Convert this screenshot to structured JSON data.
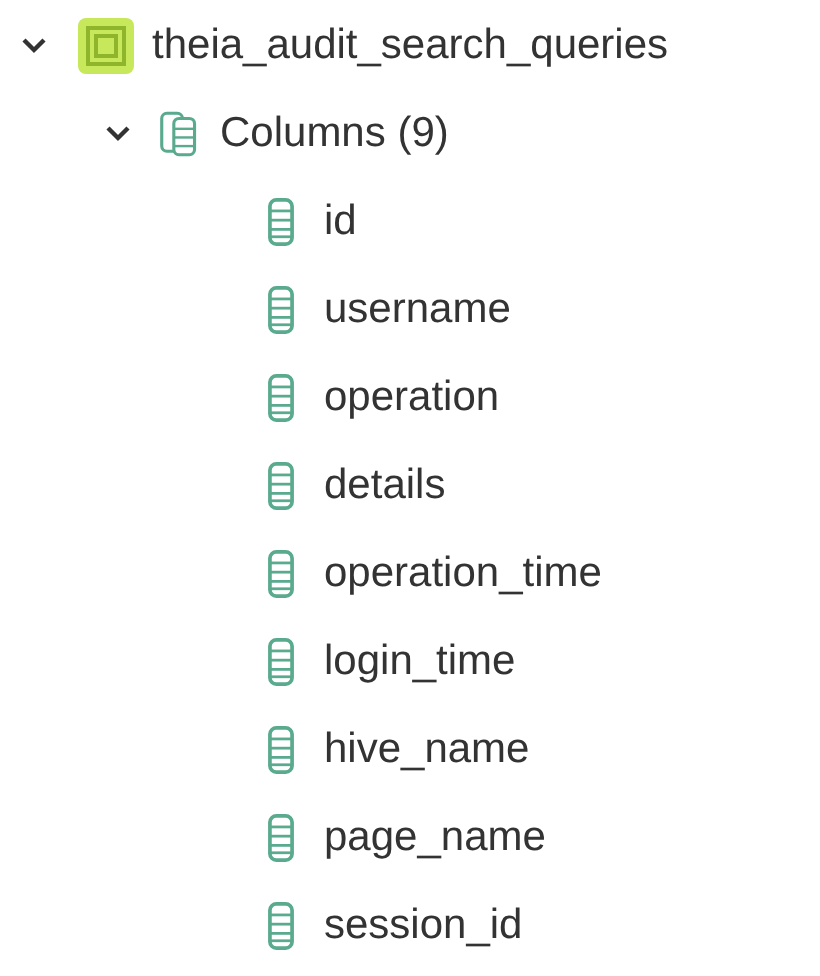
{
  "tree": [
    {
      "kind": "table",
      "label": "theia_audit_search_queries",
      "expanded": true,
      "children": [
        {
          "kind": "folder",
          "label": "Columns (9)",
          "expanded": true,
          "children": [
            {
              "kind": "column",
              "label": "id"
            },
            {
              "kind": "column",
              "label": "username"
            },
            {
              "kind": "column",
              "label": "operation"
            },
            {
              "kind": "column",
              "label": "details"
            },
            {
              "kind": "column",
              "label": "operation_time"
            },
            {
              "kind": "column",
              "label": "login_time"
            },
            {
              "kind": "column",
              "label": "hive_name"
            },
            {
              "kind": "column",
              "label": "page_name"
            },
            {
              "kind": "column",
              "label": "session_id"
            }
          ]
        }
      ]
    }
  ]
}
